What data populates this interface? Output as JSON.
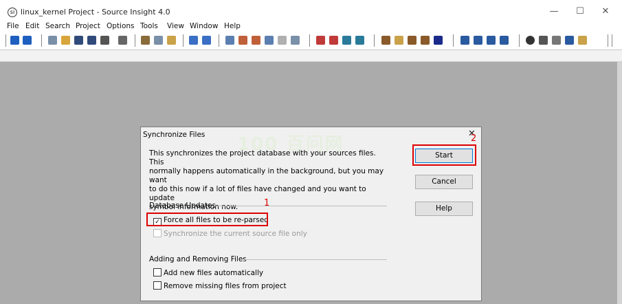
{
  "window": {
    "title": "linux_kernel Project - Source Insight 4.0",
    "controls": {
      "minimize": "—",
      "maximize": "☐",
      "close": "✕"
    }
  },
  "menu": [
    "File",
    "Edit",
    "Search",
    "Project",
    "Options",
    "Tools",
    "View",
    "Window",
    "Help"
  ],
  "dialog": {
    "title": "Synchronize Files",
    "close_glyph": "✕",
    "description": "This synchronizes the project database with your sources files. This\nnormally happens automatically in the background, but you may want\nto do this now if a lot of files have changed and you want to update\nsymbol information now.",
    "watermark": "100 百问网",
    "database_updates": {
      "label": "Database Updates",
      "force_reparse": {
        "label": "Force all files to be re-parsed",
        "checked": true
      },
      "sync_current": {
        "label": "Synchronize the current source file only",
        "checked": false,
        "disabled": true
      }
    },
    "adding_removing": {
      "label": "Adding and Removing Files",
      "add_new": {
        "label": "Add new files automatically",
        "checked": false
      },
      "remove_missing": {
        "label": "Remove missing files from project",
        "checked": false
      }
    },
    "buttons": {
      "start": "Start",
      "cancel": "Cancel",
      "help": "Help"
    },
    "annotations": {
      "one": "1",
      "two": "2"
    }
  }
}
